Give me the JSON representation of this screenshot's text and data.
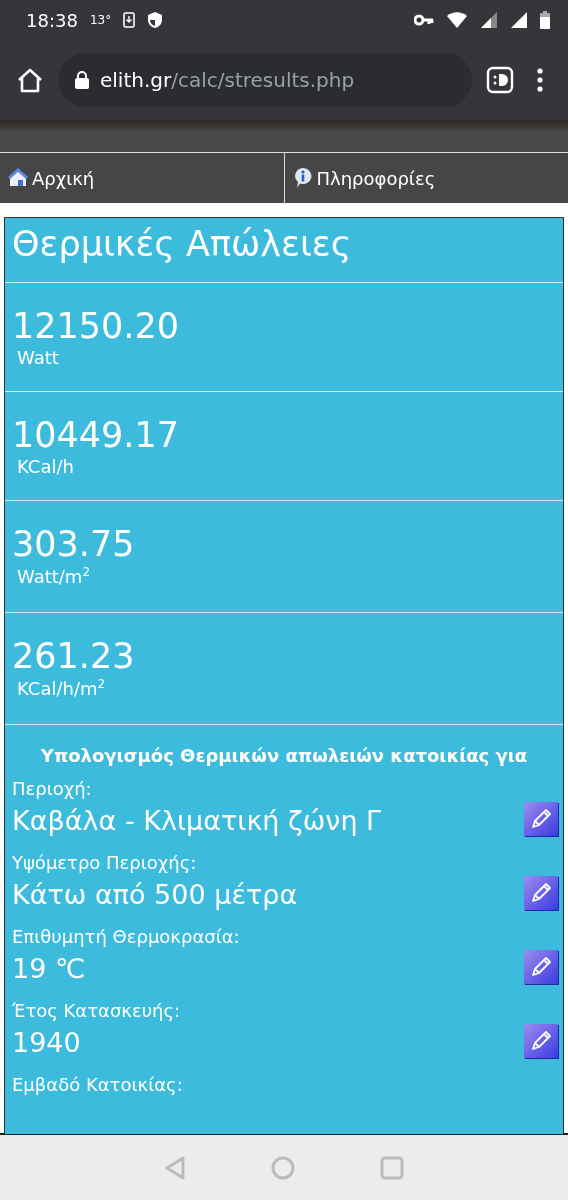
{
  "status_bar": {
    "time": "18:38",
    "temperature": "13°"
  },
  "browser": {
    "url_host": "elith.gr",
    "url_path": "/calc/stresults.php"
  },
  "nav": [
    {
      "label": "Αρχική",
      "kind": "home"
    },
    {
      "label": "Πληροφορίες",
      "kind": "info"
    }
  ],
  "results": {
    "title": "Θερμικές Απώλειες",
    "rows": [
      {
        "value": "12150.20",
        "unit": "Watt"
      },
      {
        "value": "10449.17",
        "unit": "KCal/h"
      },
      {
        "value": "303.75",
        "unit": "Watt/m$^{2}$"
      },
      {
        "value": "261.23",
        "unit": "KCal/h/m$^{2}$"
      }
    ]
  },
  "parameters": {
    "heading": "Υπολογισμός Θερμικών απωλειών κατοικίας για",
    "items": [
      {
        "label": "Περιοχή:",
        "value": "Καβάλα - Κλιματική ζώνη Γ"
      },
      {
        "label": "Υψόμετρο Περιοχής:",
        "value": "Κάτω από 500 μέτρα"
      },
      {
        "label": "Επιθυμητή Θερμοκρασία:",
        "value": "19 ℃"
      },
      {
        "label": "Έτος Κατασκευής:",
        "value": "1940"
      },
      {
        "label": "Εμβαδό Κατοικίας:"
      }
    ]
  }
}
